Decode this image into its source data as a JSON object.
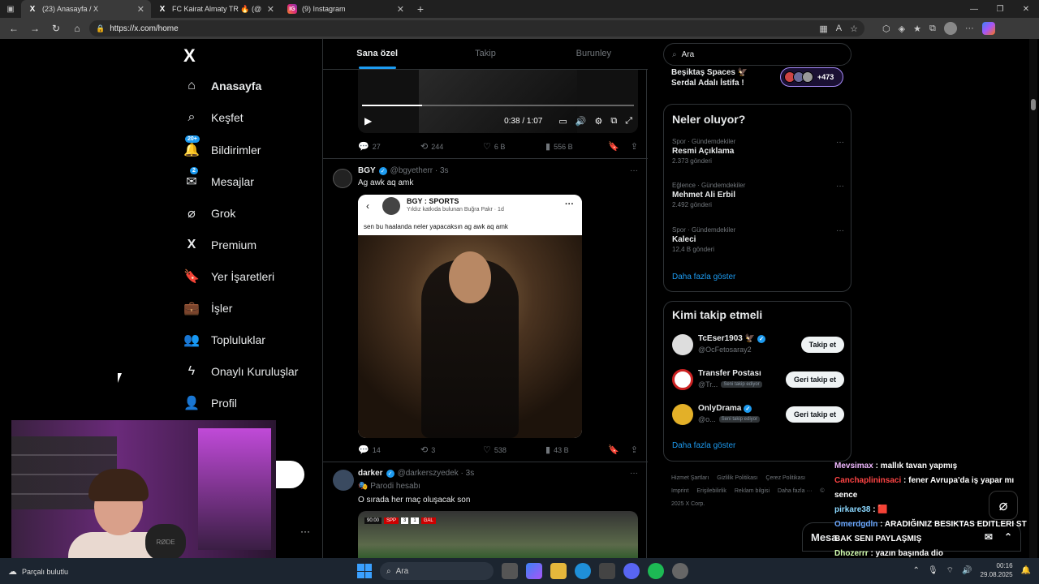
{
  "browser": {
    "tabs": [
      {
        "title": "(23) Anasayfa / X",
        "icon": "X"
      },
      {
        "title": "FC Kairat Almaty TR 🔥 (@FCKair",
        "icon": "X"
      },
      {
        "title": "(9) Instagram",
        "icon": "IG"
      }
    ],
    "url": "https://x.com/home"
  },
  "leftnav": {
    "logo": "X",
    "items": [
      {
        "label": "Anasayfa",
        "icon": "home-icon",
        "glyph": "⌂"
      },
      {
        "label": "Keşfet",
        "icon": "search-icon",
        "glyph": "⌕"
      },
      {
        "label": "Bildirimler",
        "icon": "bell-icon",
        "glyph": "🔔",
        "badge": "20+"
      },
      {
        "label": "Mesajlar",
        "icon": "envelope-icon",
        "glyph": "✉",
        "badge": "2"
      },
      {
        "label": "Grok",
        "icon": "grok-icon",
        "glyph": "⌀"
      },
      {
        "label": "Premium",
        "icon": "x-premium-icon",
        "glyph": "X"
      },
      {
        "label": "Yer İşaretleri",
        "icon": "bookmark-icon",
        "glyph": "🔖"
      },
      {
        "label": "İşler",
        "icon": "briefcase-icon",
        "glyph": "💼"
      },
      {
        "label": "Topluluklar",
        "icon": "people-icon",
        "glyph": "👥"
      },
      {
        "label": "Onaylı Kuruluşlar",
        "icon": "lightning-icon",
        "glyph": "ϟ"
      },
      {
        "label": "Profil",
        "icon": "person-icon",
        "glyph": "👤"
      }
    ]
  },
  "feed": {
    "tabs": [
      "Sana özel",
      "Takip",
      "Burunley"
    ],
    "video": {
      "time": "0:38 / 1:07",
      "progress": 0.22
    },
    "post1_stats": {
      "replies": "27",
      "reposts": "244",
      "likes": "6 B",
      "views": "556 B"
    },
    "post2": {
      "name": "BGY",
      "handle": "@bgyetherr · 3s",
      "text": "Ag awk aq amk",
      "embed": {
        "name": "BGY : SPORTS",
        "sub": "Yıldız katkıda bulunan   Buğra Pakr · 1d",
        "text": "sen bu haalanda neler yapacaksın ag awk aq amk"
      },
      "stats": {
        "replies": "14",
        "reposts": "3",
        "likes": "538",
        "views": "43 B"
      }
    },
    "post3": {
      "name": "darker",
      "handle": "@darkerszyedek · 3s",
      "label": "Parodi hesabı",
      "text": "O sırada her maç oluşacak son"
    }
  },
  "right": {
    "search_placeholder": "Ara",
    "spaces": {
      "line1": "Beşiktaş Spaces 🦅",
      "line2": "Serdal Adalı İstifa !",
      "count": "+473"
    },
    "trends_title": "Neler oluyor?",
    "trends": [
      {
        "cat": "Spor · Gündemdekiler",
        "name": "Resmi Açıklama",
        "count": "2.373 gönderi"
      },
      {
        "cat": "Eğlence · Gündemdekiler",
        "name": "Mehmet Ali Erbil",
        "count": "2.492 gönderi"
      },
      {
        "cat": "Spor · Gündemdekiler",
        "name": "Kaleci",
        "count": "12,4 B gönderi"
      }
    ],
    "show_more": "Daha fazla göster",
    "follow_title": "Kimi takip etmeli",
    "follow": [
      {
        "name": "TcEser1903 🦅",
        "handle": "@OcFetosaray2",
        "tag": "",
        "btn": "Takip et",
        "verified": true
      },
      {
        "name": "Transfer Postası",
        "handle": "@Tr...",
        "tag": "Seni takip ediyor",
        "btn": "Geri takip et",
        "verified": false
      },
      {
        "name": "OnlyDrama",
        "handle": "@o...",
        "tag": "Seni takip ediyor",
        "btn": "Geri takip et",
        "verified": true
      }
    ],
    "follow_more": "Daha fazla göster",
    "footer": [
      "Hizmet Şartları",
      "Gizlilik Politikası",
      "Çerez Politikası",
      "Imprint",
      "Erişilebilirlik",
      "Reklam bilgisi",
      "Daha fazla ···",
      "© 2025 X Corp."
    ]
  },
  "chat": [
    {
      "user": "Mevsimax",
      "msg": ": mallık tavan yapmış"
    },
    {
      "user": "Canchaplininsaci",
      "msg": ": fener Avrupa'da iş yapar mı sence"
    },
    {
      "user": "pirkare38",
      "msg": ": 🟥"
    },
    {
      "user": "Omerdgdln",
      "msg": ": ARADIĞINIZ BESIKTAS EDITLERI ST BAK SENI PAYLAŞMIŞ"
    },
    {
      "user": "Dhozerrr",
      "msg": ": yazın başında dio"
    }
  ],
  "msg_drawer": "Mesa",
  "taskbar": {
    "weather": "Parçalı bulutlu",
    "search": "Ara",
    "time": "00:16",
    "date": "29.08.2025"
  },
  "colors": {
    "accent": "#1d9bf0",
    "bg": "#000000",
    "border": "#2f3336",
    "muted": "#71767b"
  }
}
